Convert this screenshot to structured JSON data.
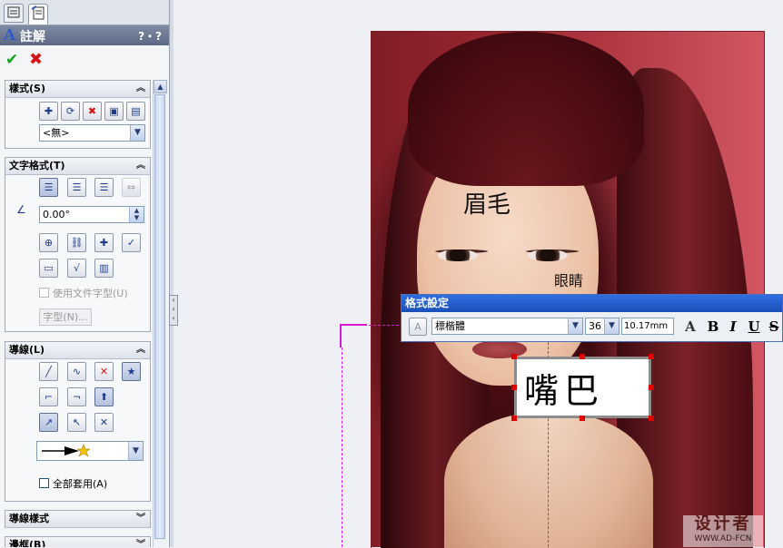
{
  "panel": {
    "title": "註解",
    "help_label": "?・?",
    "ok_icon": "✔",
    "cancel_icon": "✖",
    "style_section": {
      "header": "樣式(S)",
      "style_select_value": "<無>"
    },
    "text_format_section": {
      "header": "文字格式(T)",
      "angle_value": "0.00°",
      "use_doc_font_label": "使用文件字型(U)",
      "font_button_label": "字型(N)..."
    },
    "leader_section": {
      "header": "導線(L)",
      "apply_all_label": "全部套用(A)"
    },
    "leader_style_header": "導線樣式",
    "frame_header": "邊框(B)"
  },
  "canvas": {
    "annotation_brow": "眉毛",
    "annotation_eye": "眼睛",
    "annotation_mouth": "嘴巴"
  },
  "format_toolbar": {
    "title": "格式設定",
    "font_value": "標楷體",
    "size_value": "36",
    "height_value": "10.17mm",
    "btn_color": "A",
    "btn_bold": "B",
    "btn_italic": "I",
    "btn_underline": "U",
    "btn_strike": "S"
  },
  "watermark": {
    "line1": "设计者",
    "line2": "WWW.AD-FCN"
  },
  "colors": {
    "leader_magenta": "#d21bd2",
    "handle_red": "#e00000",
    "title_blue": "#1b4fb8"
  }
}
